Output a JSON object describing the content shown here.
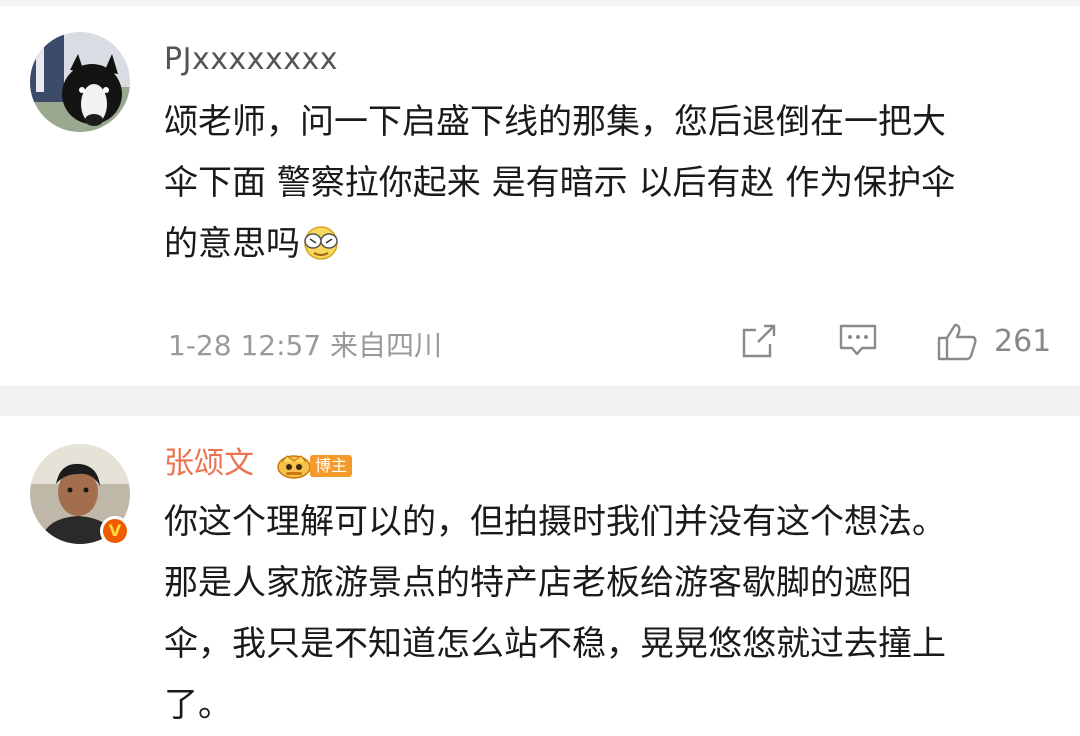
{
  "comments": [
    {
      "username": "PJxxxxxxxx",
      "text_line1": "颂老师，问一下启盛下线的那集，您后退倒在一把大",
      "text_line2": "伞下面 警察拉你起来 是有暗示 以后有赵 作为保护伞",
      "text_line3": "的意思吗",
      "emoji": "facepalm-emoji",
      "time": "1-28 12:57",
      "location": "来自四川",
      "like_count": "261",
      "icons": [
        "share-icon",
        "comment-icon",
        "like-icon"
      ]
    },
    {
      "username": "张颂文",
      "badge_label": "博主",
      "text_line1": "你这个理解可以的，但拍摄时我们并没有这个想法。",
      "text_line2": "那是人家旅游景点的特产店老板给游客歇脚的遮阳",
      "text_line3": "伞，我只是不知道怎么站不稳，晃晃悠悠就过去撞上",
      "text_line4": "了。",
      "verified_mark": "V"
    }
  ],
  "colors": {
    "accent_username": "#eb7350",
    "badge": "#f39a2a",
    "verified": "#f05a00",
    "meta_gray": "#9a9a9a"
  }
}
